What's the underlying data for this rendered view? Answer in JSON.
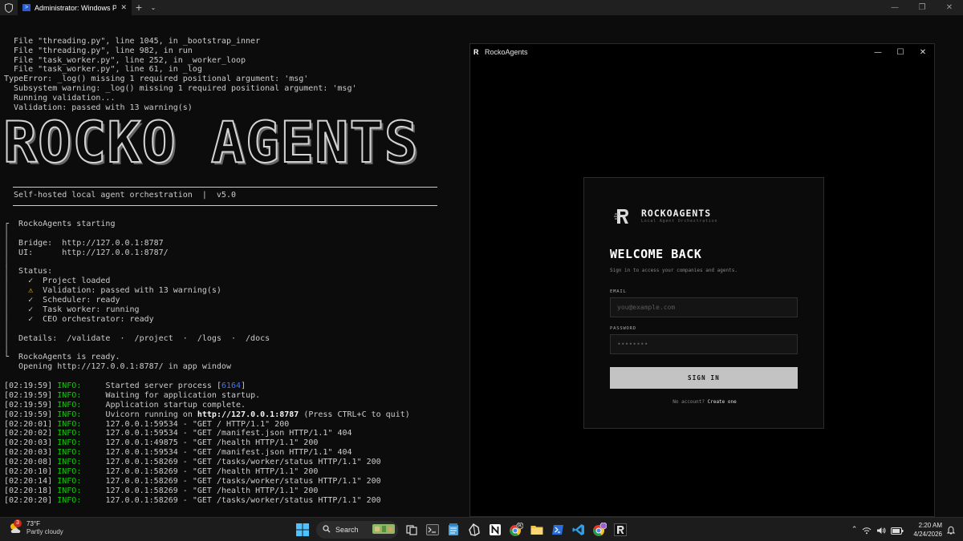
{
  "terminal": {
    "tab_title": "Administrator: Windows PowerShell",
    "traceback": [
      "  File \"threading.py\", line 1045, in _bootstrap_inner",
      "  File \"threading.py\", line 982, in run",
      "  File \"task_worker.py\", line 252, in _worker_loop",
      "  File \"task_worker.py\", line 61, in _log",
      "TypeError: _log() missing 1 required positional argument: 'msg'",
      "  Subsystem warning: _log() missing 1 required positional argument: 'msg'",
      "  Running validation...",
      "  Validation: passed with 13 warning(s)"
    ],
    "banner": "ROCKO AGENTS",
    "tagline": "  Self-hosted local agent orchestration  |  v5.0",
    "starting": "┌  RockoAgents starting",
    "bridge": "│  Bridge:  http://127.0.0.1:8787",
    "ui": "│  UI:      http://127.0.0.1:8787/",
    "status_header": "│  Status:",
    "status_ok_1": "│    ✓  Project loaded",
    "status_warn_prefix": "│    ",
    "status_warn_glyph": "⚠",
    "status_warn_text": "  Validation: passed with 13 warning(s)",
    "status_ok_2": "│    ✓  Scheduler: ready",
    "status_ok_3": "│    ✓  Task worker: running",
    "status_ok_4": "│    ✓  CEO orchestrator: ready",
    "details": "│  Details:  /validate  ·  /project  ·  /logs  ·  /docs",
    "ready": "└  RockoAgents is ready.",
    "opening": "   Opening http://127.0.0.1:8787/ in app window",
    "log_level": "INFO:",
    "logs": [
      {
        "ts": "[02:19:59]",
        "pre": "Started server process [",
        "pid": "6164",
        "post": "]"
      },
      {
        "ts": "[02:19:59]",
        "msg": "Waiting for application startup."
      },
      {
        "ts": "[02:19:59]",
        "msg": "Application startup complete."
      },
      {
        "ts": "[02:19:59]",
        "pre": "Uvicorn running on ",
        "bold": "http://127.0.0.1:8787",
        "post": " (Press CTRL+C to quit)"
      },
      {
        "ts": "[02:20:01]",
        "msg": "127.0.0.1:59534 - \"GET / HTTP/1.1\" 200"
      },
      {
        "ts": "[02:20:02]",
        "msg": "127.0.0.1:59534 - \"GET /manifest.json HTTP/1.1\" 404"
      },
      {
        "ts": "[02:20:03]",
        "msg": "127.0.0.1:49875 - \"GET /health HTTP/1.1\" 200"
      },
      {
        "ts": "[02:20:03]",
        "msg": "127.0.0.1:59534 - \"GET /manifest.json HTTP/1.1\" 404"
      },
      {
        "ts": "[02:20:08]",
        "msg": "127.0.0.1:58269 - \"GET /tasks/worker/status HTTP/1.1\" 200"
      },
      {
        "ts": "[02:20:10]",
        "msg": "127.0.0.1:58269 - \"GET /health HTTP/1.1\" 200"
      },
      {
        "ts": "[02:20:14]",
        "msg": "127.0.0.1:58269 - \"GET /tasks/worker/status HTTP/1.1\" 200"
      },
      {
        "ts": "[02:20:18]",
        "msg": "127.0.0.1:58269 - \"GET /health HTTP/1.1\" 200"
      },
      {
        "ts": "[02:20:20]",
        "msg": "127.0.0.1:58269 - \"GET /tasks/worker/status HTTP/1.1\" 200"
      }
    ]
  },
  "app": {
    "window_title": "RockoAgents",
    "brand_name": "ROCKOAGENTS",
    "brand_sub": "Local Agent Orchestration",
    "welcome": "WELCOME BACK",
    "subtitle": "Sign in to access your companies and agents.",
    "email_label": "EMAIL",
    "email_placeholder": "you@example.com",
    "password_label": "PASSWORD",
    "password_placeholder": "••••••••",
    "signin_label": "SIGN IN",
    "no_account": "No account? ",
    "create_one": "Create one"
  },
  "taskbar": {
    "weather_temp": "73°F",
    "weather_desc": "Partly cloudy",
    "weather_badge": "3",
    "search_label": "Search",
    "time": "2:20 AM",
    "date": "4/24/2026"
  },
  "colors": {
    "info_green": "#16c60c",
    "pid_blue": "#3b78ff",
    "warn_yellow": "#f9c53a",
    "accent_blue": "#3b78ff"
  }
}
